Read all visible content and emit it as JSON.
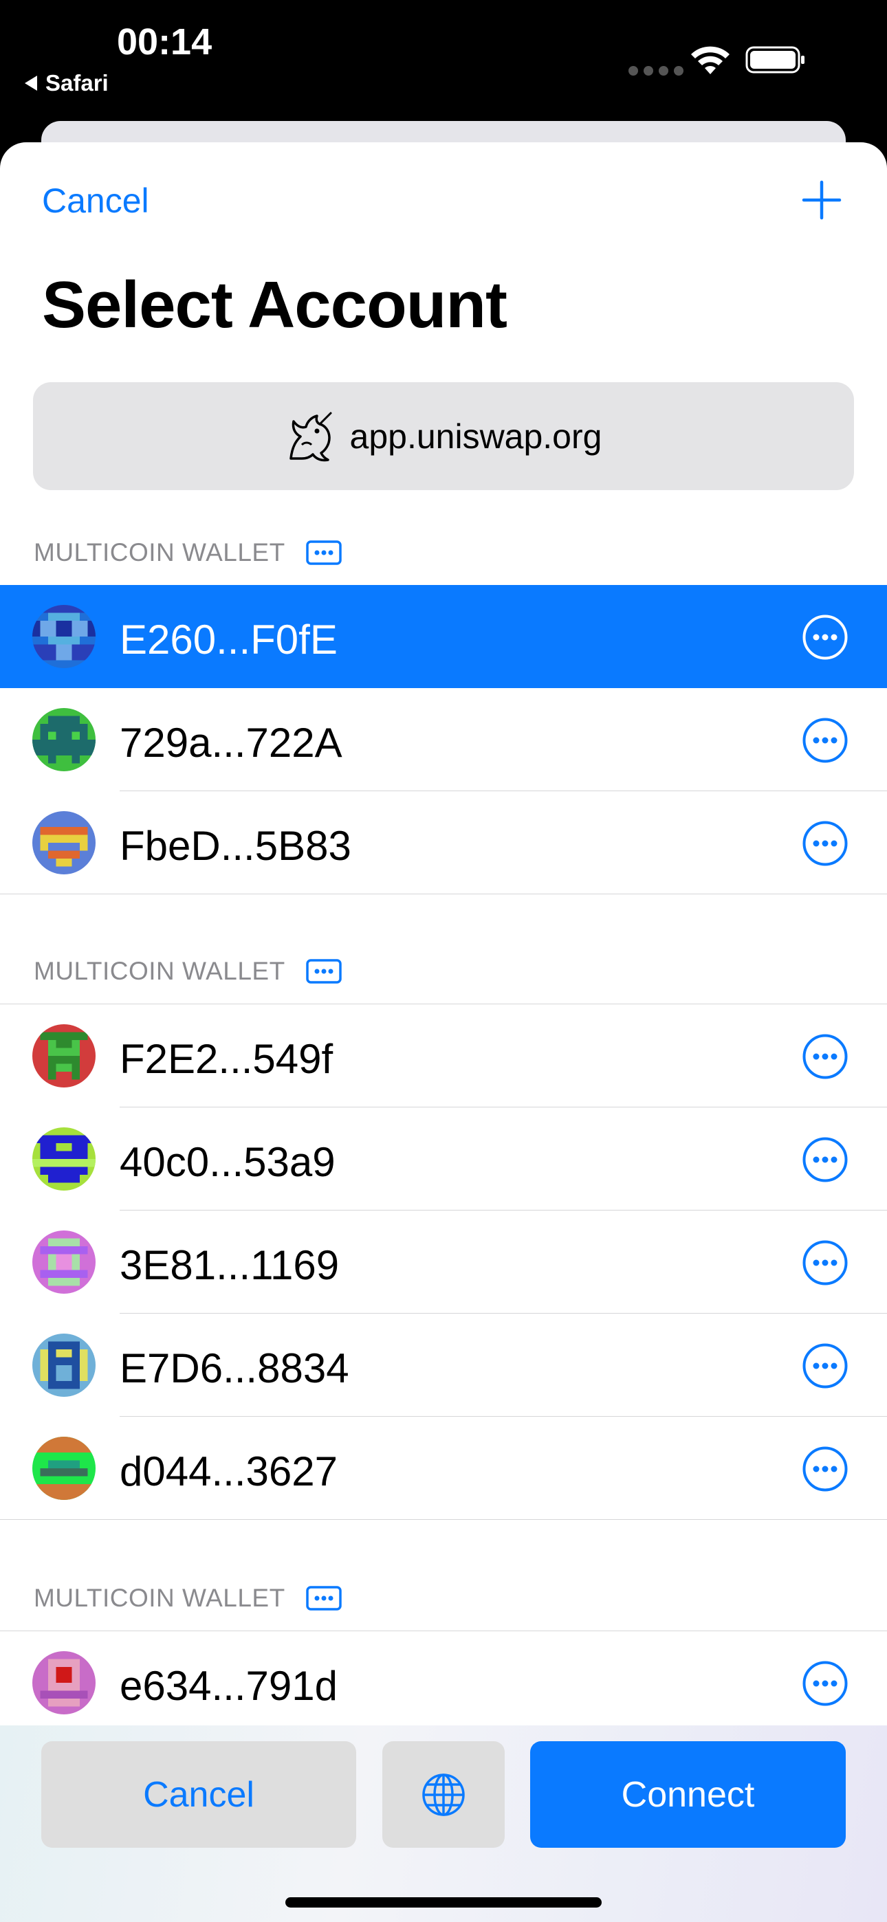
{
  "status_bar": {
    "time": "00:14",
    "back_app": "Safari"
  },
  "nav": {
    "cancel_label": "Cancel",
    "add_icon": "plus-icon"
  },
  "title": "Select Account",
  "site": {
    "logo_icon": "uniswap-unicorn-logo",
    "url": "app.uniswap.org"
  },
  "sections": [
    {
      "label": "MULTICOIN WALLET",
      "accounts": [
        {
          "address": "E260...F0fE",
          "selected": true
        },
        {
          "address": "729a...722A",
          "selected": false
        },
        {
          "address": "FbeD...5B83",
          "selected": false
        }
      ]
    },
    {
      "label": "MULTICOIN WALLET",
      "accounts": [
        {
          "address": "F2E2...549f",
          "selected": false
        },
        {
          "address": "40c0...53a9",
          "selected": false
        },
        {
          "address": "3E81...1169",
          "selected": false
        },
        {
          "address": "E7D6...8834",
          "selected": false
        },
        {
          "address": "d044...3627",
          "selected": false
        }
      ]
    },
    {
      "label": "MULTICOIN WALLET",
      "accounts": [
        {
          "address": "e634...791d",
          "selected": false
        }
      ]
    }
  ],
  "bottom": {
    "cancel_label": "Cancel",
    "globe_icon": "globe-icon",
    "connect_label": "Connect"
  },
  "colors": {
    "accent": "#0a7aff",
    "selected_row": "#0a7aff",
    "section_label": "#8a8a8e",
    "pill_bg": "#e4e4e6"
  }
}
